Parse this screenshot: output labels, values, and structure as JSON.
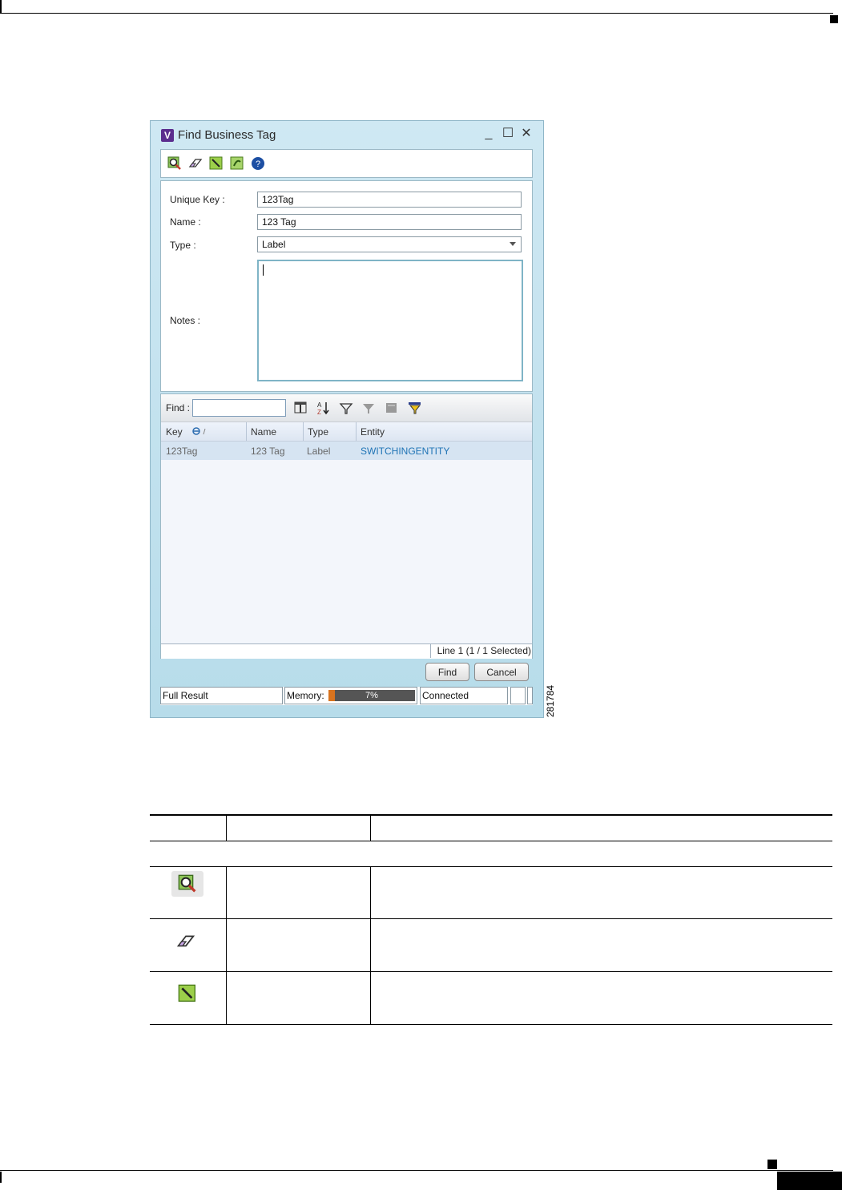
{
  "window": {
    "title": "Find Business Tag",
    "app_icon_letter": "V",
    "controls": {
      "minimize": "_",
      "maximize": "☐",
      "close": "✕"
    }
  },
  "toolbar": {
    "icons": [
      "find-icon",
      "clear-eraser-icon",
      "edit-notes-icon",
      "refresh-icon",
      "help-icon"
    ]
  },
  "form": {
    "unique_key_label": "Unique Key :",
    "unique_key_value": "123Tag",
    "name_label": "Name :",
    "name_value": "123 Tag",
    "type_label": "Type :",
    "type_value": "Label",
    "notes_label": "Notes :",
    "notes_value": ""
  },
  "results": {
    "find_label": "Find :",
    "find_value": "",
    "columns": [
      "Key",
      "Name",
      "Type",
      "Entity"
    ],
    "rows": [
      {
        "key": "123Tag",
        "name": "123 Tag",
        "type": "Label",
        "entity": "SWITCHINGENTITY"
      }
    ],
    "line_status": "Line 1 (1 / 1 Selected)"
  },
  "buttons": {
    "find": "Find",
    "cancel": "Cancel"
  },
  "statusbar": {
    "result": "Full Result",
    "memory_label": "Memory:",
    "memory_percent": "7%",
    "memory_fraction": 0.07,
    "connection": "Connected"
  },
  "figure_number": "281784",
  "colors": {
    "link": "#1e73b5",
    "selected_row": "#d6e4f2",
    "notes_border": "#7fb4c6"
  }
}
